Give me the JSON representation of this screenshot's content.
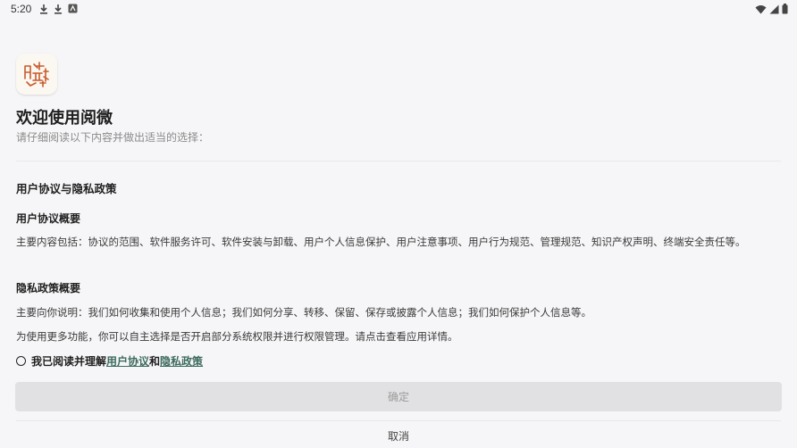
{
  "status_bar": {
    "time": "5:20",
    "left_icons": [
      "download-icon",
      "download-icon",
      "app-notification-icon"
    ],
    "right_icons": [
      "wifi-icon",
      "signal-icon",
      "battery-icon"
    ]
  },
  "app": {
    "logo_icon": "yuewei-logo-icon",
    "title": "欢迎使用阅微",
    "subtitle": "请仔细阅读以下内容并做出适当的选择："
  },
  "policy": {
    "heading": "用户协议与隐私政策",
    "user_agreement_heading": "用户协议概要",
    "user_agreement_body": "主要内容包括：协议的范围、软件服务许可、软件安装与卸载、用户个人信息保护、用户注意事项、用户行为规范、管理规范、知识产权声明、终端安全责任等。",
    "privacy_heading": "隐私政策概要",
    "privacy_body": "主要向你说明：我们如何收集和使用个人信息；我们如何分享、转移、保留、保存或披露个人信息；我们如何保护个人信息等。",
    "permission_note": "为使用更多功能，你可以自主选择是否开启部分系统权限并进行权限管理。请点击查看应用详情。"
  },
  "agree": {
    "prefix": "我已阅读并理解",
    "user_agreement_link": "用户协议",
    "conjunction": "和",
    "privacy_link": "隐私政策",
    "checked": false
  },
  "actions": {
    "confirm_label": "确定",
    "cancel_label": "取消"
  },
  "colors": {
    "background": "#f6f6f8",
    "link": "#3c6b5c",
    "confirm_disabled_bg": "#e1e1e3",
    "confirm_disabled_text": "#9b9b9b"
  }
}
